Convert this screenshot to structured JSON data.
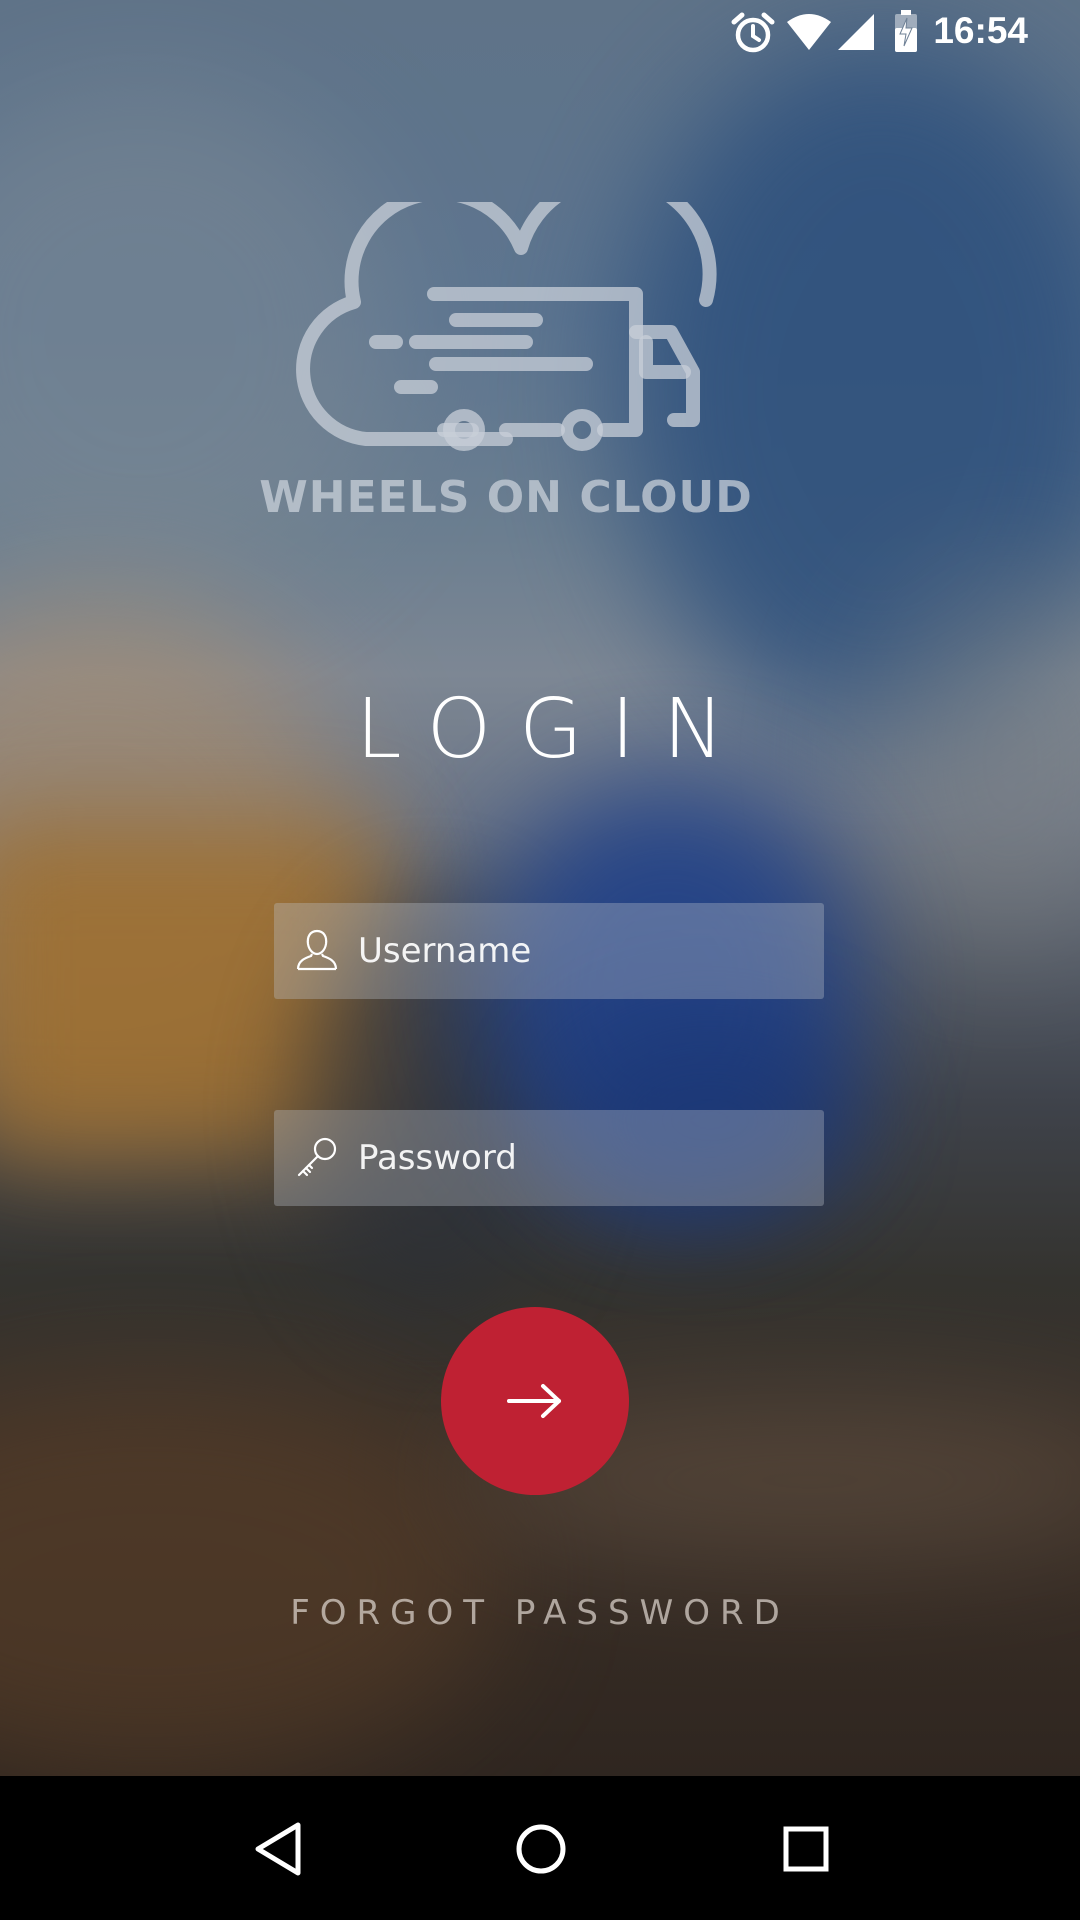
{
  "status_bar": {
    "time": "16:54",
    "icons": [
      "alarm-icon",
      "wifi-icon",
      "cell-signal-icon",
      "battery-charging-icon"
    ]
  },
  "brand": {
    "name": "WHEELS ON CLOUD",
    "logo_icon": "cloud-truck-logo"
  },
  "login": {
    "title": "LOGIN",
    "username": {
      "placeholder": "Username",
      "value": "",
      "icon": "user-icon"
    },
    "password": {
      "placeholder": "Password",
      "value": "",
      "icon": "key-icon"
    },
    "submit_icon": "arrow-right-icon",
    "forgot_label": "FORGOT PASSWORD"
  },
  "nav_bar": {
    "buttons": [
      "back-icon",
      "home-icon",
      "recents-icon"
    ]
  },
  "colors": {
    "accent": "#bf2133",
    "text": "#ffffff"
  }
}
